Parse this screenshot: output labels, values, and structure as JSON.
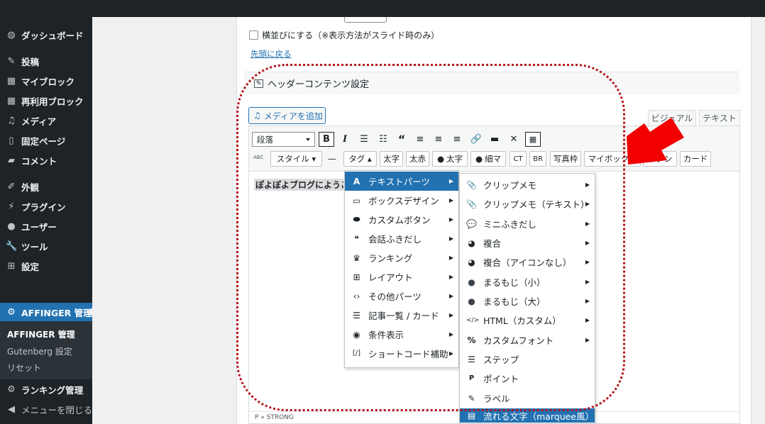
{
  "sidebar": {
    "items": [
      {
        "label": "ダッシュボード",
        "icon": "dashboard-icon"
      },
      {
        "label": "投稿",
        "icon": "pin-icon"
      },
      {
        "label": "マイブロック",
        "icon": "grid-icon"
      },
      {
        "label": "再利用ブロック",
        "icon": "grid-icon"
      },
      {
        "label": "メディア",
        "icon": "media-icon"
      },
      {
        "label": "固定ページ",
        "icon": "page-icon"
      },
      {
        "label": "コメント",
        "icon": "comment-icon"
      },
      {
        "label": "外観",
        "icon": "appearance-icon"
      },
      {
        "label": "プラグイン",
        "icon": "plugin-icon"
      },
      {
        "label": "ユーザー",
        "icon": "user-icon"
      },
      {
        "label": "ツール",
        "icon": "wrench-icon"
      },
      {
        "label": "設定",
        "icon": "settings-icon"
      }
    ],
    "active": {
      "label": "AFFINGER 管理",
      "icon": "gear-icon"
    },
    "submenu": [
      "AFFINGER 管理",
      "Gutenberg 設定",
      "リセット"
    ],
    "ranking": {
      "label": "ランキング管理",
      "icon": "gear-icon"
    },
    "collapse": {
      "label": "メニューを閉じる",
      "icon": "collapse-icon"
    }
  },
  "content": {
    "checkbox_label": "横並びにする（※表示方法がスライド時のみ）",
    "top_link": "先頭に戻る",
    "section_title": "ヘッダーコンテンツ設定",
    "media_button": "メディアを追加",
    "tab_visual": "ビジュアル",
    "tab_text": "テキスト"
  },
  "toolbar": {
    "format": "段落",
    "row2": {
      "abc": "ABC",
      "style": "スタイル ▾",
      "dash": "—",
      "tag": "タグ ▴",
      "bold": "太字",
      "bold_red": "太赤",
      "person_bold": "太字",
      "person_small": "細マ",
      "ct": "CT",
      "br": "BR",
      "photo": "写真枠",
      "mybox": "マイボックス",
      "button": "ボタン",
      "card": "カード"
    }
  },
  "editor": {
    "text": "ぽよぽよブログにようこそ",
    "status": "P » STRONG"
  },
  "menu1": [
    {
      "label": "テキストパーツ",
      "icon": "A"
    },
    {
      "label": "ボックスデザイン",
      "icon": "▭"
    },
    {
      "label": "カスタムボタン",
      "icon": "⬬"
    },
    {
      "label": "会話ふきだし",
      "icon": "❝"
    },
    {
      "label": "ランキング",
      "icon": "♛"
    },
    {
      "label": "レイアウト",
      "icon": "⊞"
    },
    {
      "label": "その他パーツ",
      "icon": "‹›"
    },
    {
      "label": "記事一覧 / カード",
      "icon": "☰"
    },
    {
      "label": "条件表示",
      "icon": "◉"
    },
    {
      "label": "ショートコード補助",
      "icon": "[/]"
    }
  ],
  "menu2": [
    {
      "label": "クリップメモ",
      "icon": "📎"
    },
    {
      "label": "クリップメモ（テキスト）",
      "icon": "📎"
    },
    {
      "label": "ミニふきだし",
      "icon": "💬"
    },
    {
      "label": "複合",
      "icon": "◕"
    },
    {
      "label": "複合（アイコンなし）",
      "icon": "◕"
    },
    {
      "label": "まるもじ（小）",
      "icon": "●"
    },
    {
      "label": "まるもじ（大）",
      "icon": "●"
    },
    {
      "label": "HTML（カスタム）",
      "icon": "</>"
    },
    {
      "label": "カスタムフォント",
      "icon": "%"
    },
    {
      "label": "ステップ",
      "icon": "☰"
    },
    {
      "label": "ポイント",
      "icon": "P"
    },
    {
      "label": "ラベル",
      "icon": "✎"
    },
    {
      "label": "流れる文字（marquee風）",
      "icon": "▤"
    }
  ]
}
